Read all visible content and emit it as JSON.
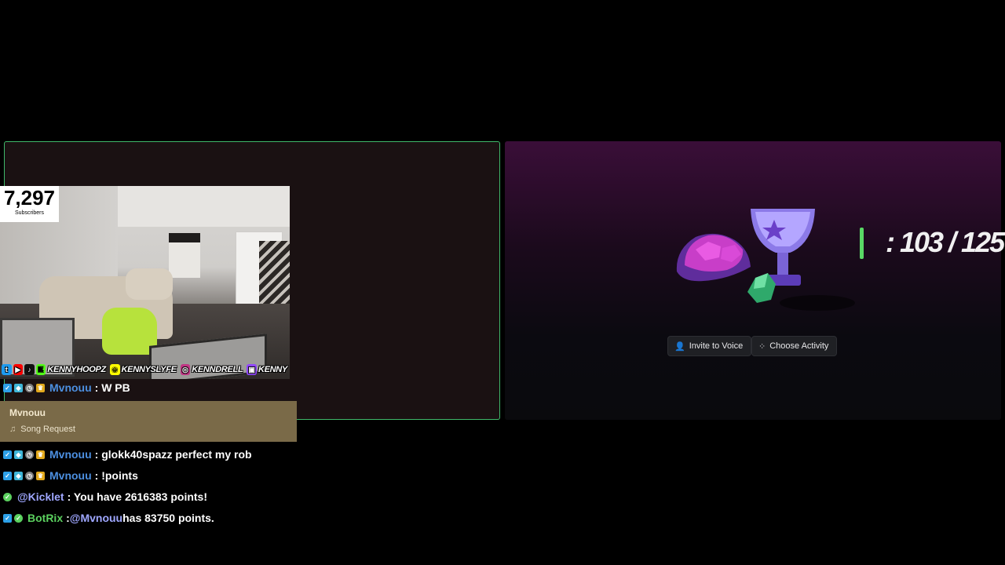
{
  "stream": {
    "subscribers": {
      "count": "7,297",
      "label": "Subscribers"
    },
    "socials": [
      {
        "icon": "twitter-icon",
        "glyph": "🐦",
        "color": "#1d9bf0",
        "handle": ""
      },
      {
        "icon": "youtube-icon",
        "glyph": "▶",
        "color": "#ff0000",
        "handle": ""
      },
      {
        "icon": "tiktok-icon",
        "glyph": "♪",
        "color": "#111111",
        "handle": ""
      },
      {
        "icon": "kick-icon",
        "glyph": "K",
        "color": "#53fc18",
        "handle": "KENNYHOOPZ"
      },
      {
        "icon": "snapchat-icon",
        "glyph": "👻",
        "color": "#fffc00",
        "handle": "KENNYSLYFE"
      },
      {
        "icon": "instagram-icon",
        "glyph": "◎",
        "color": "#c13584",
        "handle": "KENNDRELL"
      },
      {
        "icon": "twitch-icon",
        "glyph": "▣",
        "color": "#9146ff",
        "handle": "KENNY"
      }
    ]
  },
  "chat": {
    "first_message": {
      "user": "Mvnouu",
      "text": ": W PB"
    },
    "song_request": {
      "user": "Mvnouu",
      "type": "Song Request"
    },
    "messages": [
      {
        "user": "Mvnouu",
        "text": ": glokk40spazz perfect my rob"
      },
      {
        "user": "Mvnouu",
        "text": ": !points"
      },
      {
        "user": "@Kicklet",
        "text": ": You have 2616383 points!"
      },
      {
        "user": "BotRix",
        "text": ": ",
        "mention": "@Mvnouu",
        "tail": " has 83750 points."
      }
    ]
  },
  "activity": {
    "counter": ": 103 / 125",
    "invite_label": "Invite to Voice",
    "choose_label": "Choose Activity"
  },
  "colors": {
    "accent_green": "#3fb86a",
    "chat_user_blue": "#4c8fe0",
    "bot_green": "#5bd15f"
  }
}
